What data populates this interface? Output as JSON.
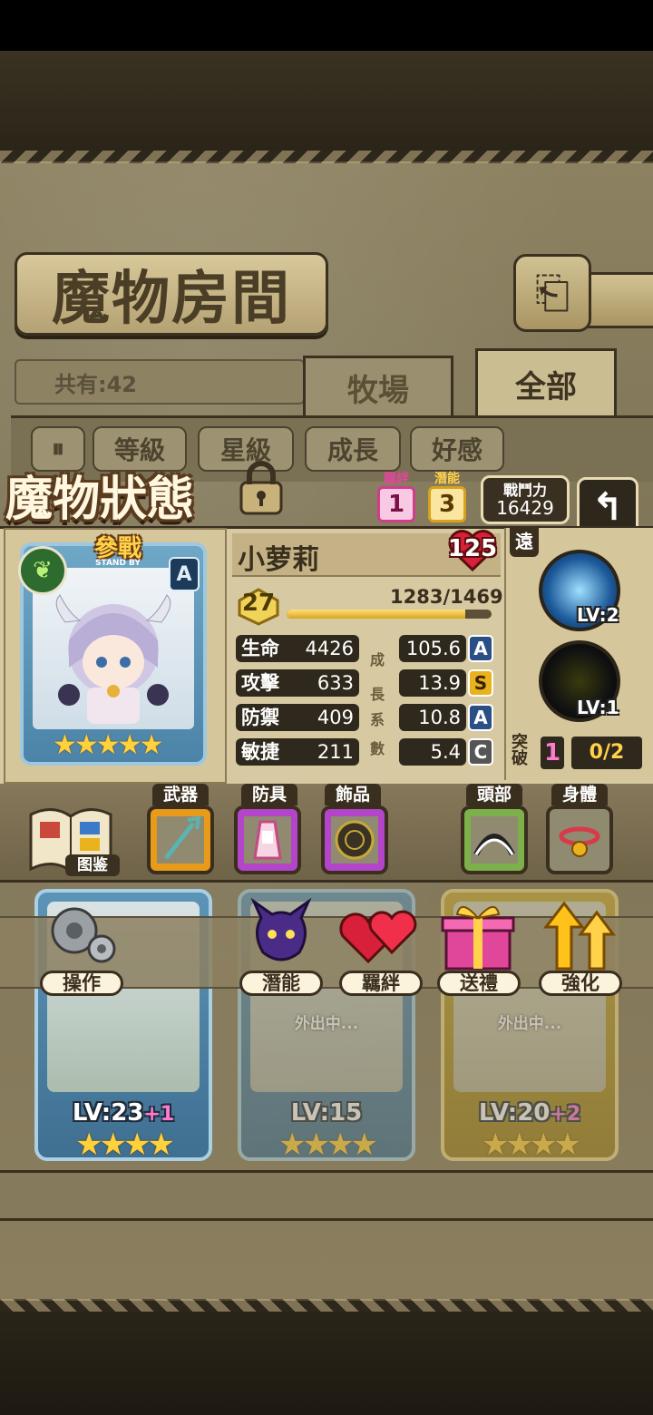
{
  "screen": {
    "title": "魔物房間",
    "count_label": "共有:42",
    "tabs": [
      {
        "label": "牧場"
      },
      {
        "label": "全部"
      }
    ],
    "sort_buttons": [
      {
        "label": "等級"
      },
      {
        "label": "星級"
      },
      {
        "label": "成長"
      },
      {
        "label": "好感"
      }
    ]
  },
  "status": {
    "title": "魔物狀態",
    "bond": {
      "label": "羈絆",
      "value": "1"
    },
    "potential": {
      "label": "潛能",
      "value": "3"
    },
    "power": {
      "label": "戰鬥力",
      "value": "16429"
    }
  },
  "monster": {
    "name": "小萝莉",
    "affinity": "125",
    "level": "27",
    "exp_text": "1283/1469",
    "exp_ratio": 0.873,
    "stand_by": "參戰",
    "stand_by_sub": "STAND BY",
    "element_icon": "leaf-icon",
    "rank": "A",
    "stars": "★★★★★",
    "stats": [
      {
        "label": "生命",
        "value": "4426",
        "growth": "105.6",
        "grade": "A"
      },
      {
        "label": "攻擊",
        "value": "633",
        "growth": "13.9",
        "grade": "S"
      },
      {
        "label": "防禦",
        "value": "409",
        "growth": "10.8",
        "grade": "A"
      },
      {
        "label": "敏捷",
        "value": "211",
        "growth": "5.4",
        "grade": "C"
      }
    ],
    "growth_chars": [
      "成",
      "長",
      "系",
      "數"
    ],
    "range_tag": "遠",
    "skills": [
      {
        "lv": "LV:2",
        "icon": "lightning-icon"
      },
      {
        "lv": "LV:1",
        "icon": "dark-slash-icon"
      }
    ],
    "break_label": "突破",
    "break_value": "1",
    "break_progress": "0/2"
  },
  "equipment": {
    "book_label": "图鉴",
    "slots": [
      {
        "label": "武器",
        "icon": "trident-icon"
      },
      {
        "label": "防具",
        "icon": "maid-dress-icon"
      },
      {
        "label": "飾品",
        "icon": "coin-icon"
      },
      {
        "label": "頭部",
        "icon": "headband-icon"
      },
      {
        "label": "身體",
        "icon": "bell-collar-icon"
      }
    ]
  },
  "actions": [
    {
      "label": "操作",
      "icon": "gear-icon"
    },
    {
      "label": "潛能",
      "icon": "demon-icon"
    },
    {
      "label": "羈絆",
      "icon": "hearts-icon"
    },
    {
      "label": "送禮",
      "icon": "gift-icon"
    },
    {
      "label": "強化",
      "icon": "up-arrows-icon"
    }
  ],
  "grid": [
    {
      "lv": "LV:23",
      "plus": "+1",
      "stars": "★★★★",
      "status": ""
    },
    {
      "lv": "LV:15",
      "plus": "",
      "stars": "★★★★",
      "status": "外出中..."
    },
    {
      "lv": "LV:20",
      "plus": "+2",
      "stars": "★★★★",
      "status": "外出中..."
    }
  ],
  "colors": {
    "accent": "#ffd24a",
    "panel": "#d7c9a1",
    "card_blue": "#5c94b8",
    "card_gold": "#c9a935"
  }
}
